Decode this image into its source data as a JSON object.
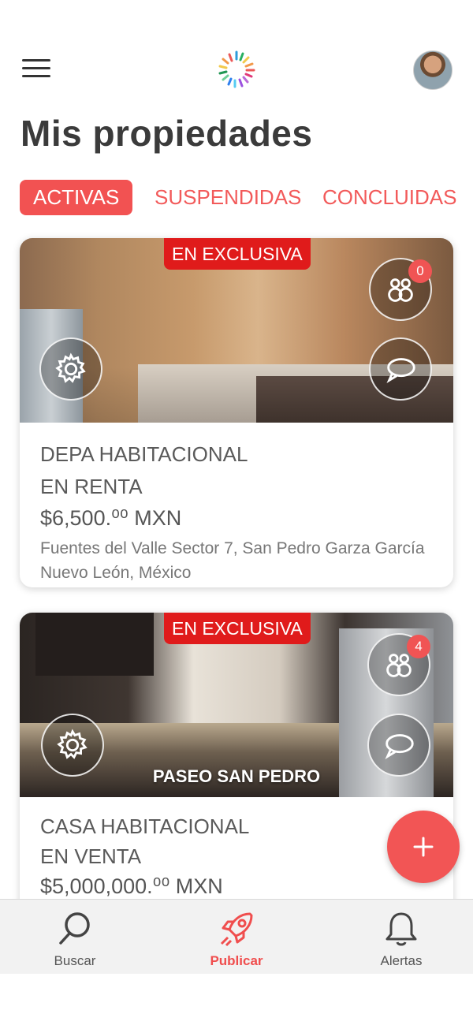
{
  "header": {
    "menu_icon": "hamburger-menu-icon",
    "logo_icon": "burst-logo-icon",
    "avatar_icon": "user-avatar"
  },
  "page": {
    "title": "Mis propiedades"
  },
  "tabs": [
    {
      "label": "ACTIVAS",
      "active": true
    },
    {
      "label": "SUSPENDIDAS",
      "active": false
    },
    {
      "label": "CONCLUIDAS",
      "active": false
    }
  ],
  "listings": [
    {
      "badge": "EN EXCLUSIVA",
      "interested_count": "0",
      "type_line1": "DEPA HABITACIONAL",
      "type_line2": "EN RENTA",
      "price": "$6,500.⁰⁰ MXN",
      "address_line1": "Fuentes del Valle Sector 7, San Pedro Garza García",
      "address_line2": "Nuevo León, México",
      "caption": ""
    },
    {
      "badge": "EN EXCLUSIVA",
      "interested_count": "4",
      "type_line1": "CASA HABITACIONAL",
      "type_line2": "EN VENTA",
      "price": "$5,000,000.⁰⁰ MXN",
      "caption": "PASEO SAN PEDRO"
    }
  ],
  "bottom_nav": [
    {
      "label": "Buscar",
      "icon": "search-icon",
      "active": false
    },
    {
      "label": "Publicar",
      "icon": "rocket-icon",
      "active": true
    },
    {
      "label": "Alertas",
      "icon": "bell-icon",
      "active": false
    }
  ],
  "colors": {
    "accent": "#f25252",
    "badge": "#e01b1b",
    "text_dark": "#3b3b3b"
  }
}
